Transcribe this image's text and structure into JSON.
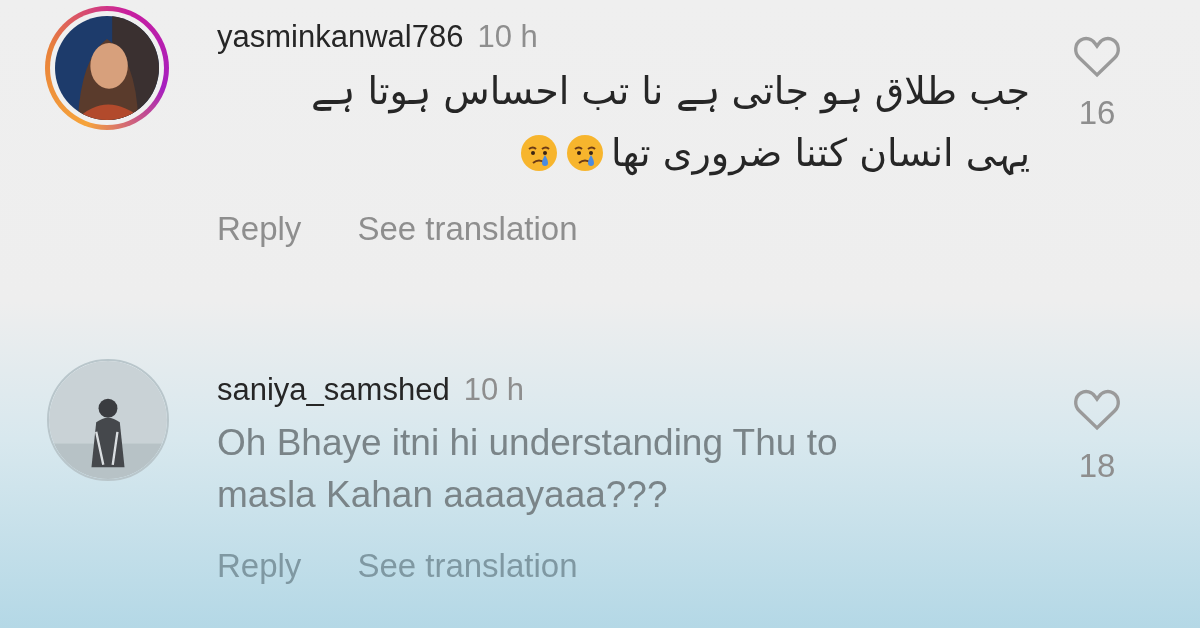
{
  "comments": [
    {
      "username": "yasminkanwal786",
      "time": "10 h",
      "story_ring": true,
      "rtl": true,
      "lines": [
        "جب طلاق ہو جاتی ہے نا تب احساس ہوتا ہے",
        "یہی انسان کتنا ضروری تھا"
      ],
      "like_count": "16",
      "actions": [
        "Reply",
        "See translation"
      ]
    },
    {
      "username": "saniya_samshed",
      "time": "10 h",
      "story_ring": false,
      "rtl": false,
      "lines": [
        "Oh Bhaye itni hi understanding Thu to",
        "masla Kahan aaaayaaa???"
      ],
      "like_count": "18",
      "actions": [
        "Reply",
        "See translation"
      ]
    }
  ]
}
